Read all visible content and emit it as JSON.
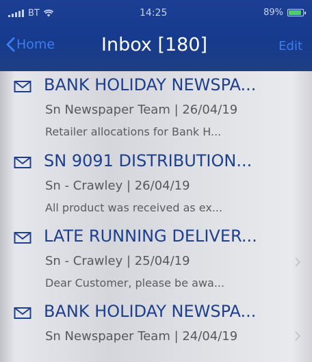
{
  "status_bar": {
    "carrier": "BT",
    "time": "14:25",
    "battery": "89%",
    "battery_level": 0.89
  },
  "nav": {
    "back_label": "Home",
    "title": "Inbox [180]",
    "edit_label": "Edit"
  },
  "colors": {
    "header_bg": "#173b8e",
    "accent": "#3b7df3",
    "subject": "#1d3f8c"
  },
  "messages": [
    {
      "subject": "BANK HOLIDAY NEWSPA...",
      "meta": "Sn Newspaper Team | 26/04/19",
      "preview": "Retailer allocations for Bank H..."
    },
    {
      "subject": "SN 9091 DISTRIBUTION...",
      "meta": "Sn - Crawley | 26/04/19",
      "preview": "All product was received as ex..."
    },
    {
      "subject": "LATE RUNNING DELIVER...",
      "meta": "Sn - Crawley | 25/04/19",
      "preview": "Dear Customer, please be awa..."
    },
    {
      "subject": "BANK HOLIDAY NEWSPA...",
      "meta": "Sn Newspaper Team | 24/04/19",
      "preview": ""
    }
  ],
  "icons": {
    "message": "envelope-icon",
    "back": "chevron-left-icon",
    "row": "chevron-right-icon"
  }
}
